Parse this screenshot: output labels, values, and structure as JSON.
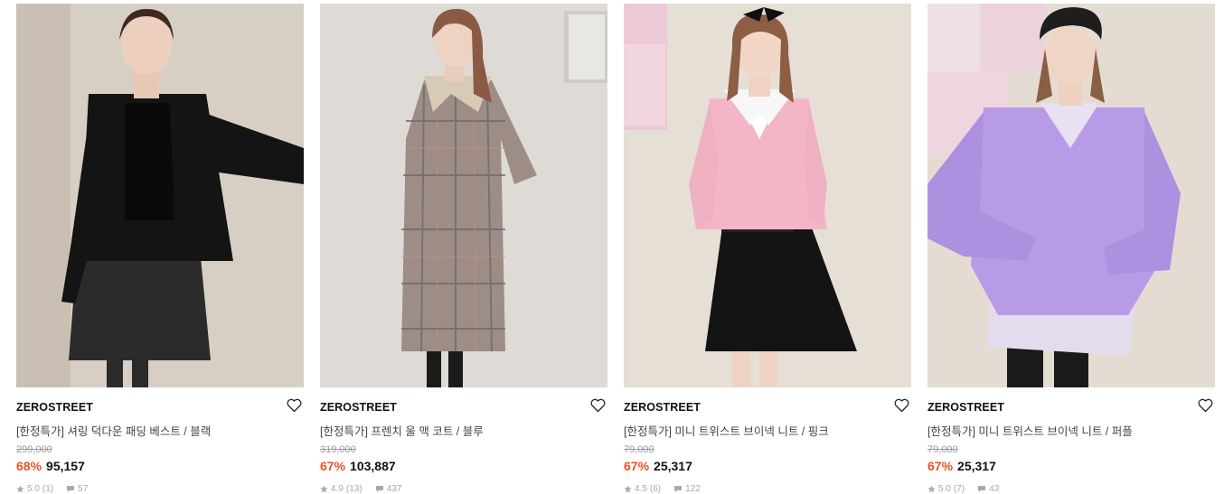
{
  "products": [
    {
      "brand": "ZEROSTREET",
      "name": "[한정특가] 셔링 덕다운 패딩 베스트 / 블랙",
      "original_price": "299,000",
      "discount": "68%",
      "price": "95,157",
      "rating": "5.0",
      "review_count": "(1)",
      "comments": "57",
      "image_icon": "product-photo-black-padding-vest",
      "accent_color": "#1a1a1a"
    },
    {
      "brand": "ZEROSTREET",
      "name": "[한정특가] 프렌치 울 맥 코트 / 블루",
      "original_price": "319,000",
      "discount": "67%",
      "price": "103,887",
      "rating": "4.9",
      "review_count": "(13)",
      "comments": "437",
      "image_icon": "product-photo-plaid-wool-coat",
      "accent_color": "#8d7b74"
    },
    {
      "brand": "ZEROSTREET",
      "name": "[한정특가] 미니 트위스트 브이넥 니트 / 핑크",
      "original_price": "79,000",
      "discount": "67%",
      "price": "25,317",
      "rating": "4.5",
      "review_count": "(6)",
      "comments": "122",
      "image_icon": "product-photo-pink-vneck-knit",
      "accent_color": "#f2b6c6"
    },
    {
      "brand": "ZEROSTREET",
      "name": "[한정특가] 미니 트위스트 브이넥 니트 / 퍼플",
      "original_price": "79,000",
      "discount": "67%",
      "price": "25,317",
      "rating": "5.0",
      "review_count": "(7)",
      "comments": "43",
      "image_icon": "product-photo-purple-vneck-knit",
      "accent_color": "#b79be6"
    }
  ],
  "colors": {
    "discount": "#f0521e",
    "strikethrough": "#999999",
    "meta": "#aaaaaa"
  }
}
